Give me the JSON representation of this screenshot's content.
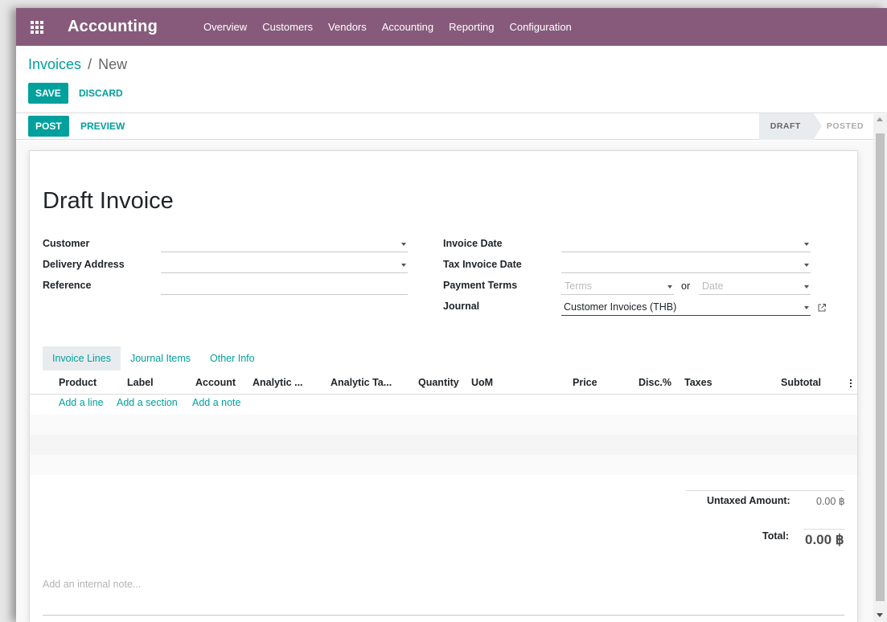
{
  "navbar": {
    "brand": "Accounting",
    "menu": [
      "Overview",
      "Customers",
      "Vendors",
      "Accounting",
      "Reporting",
      "Configuration"
    ]
  },
  "breadcrumb": {
    "parent": "Invoices",
    "separator": "/",
    "current": "New"
  },
  "control": {
    "save": "SAVE",
    "discard": "DISCARD"
  },
  "statusbar": {
    "post": "POST",
    "preview": "PREVIEW",
    "states": [
      "DRAFT",
      "POSTED"
    ]
  },
  "form": {
    "title": "Draft Invoice",
    "left_labels": [
      "Customer",
      "Delivery Address",
      "Reference"
    ],
    "right_labels": [
      "Invoice Date",
      "Tax Invoice Date",
      "Payment Terms",
      "Journal"
    ],
    "terms_placeholder": "Terms",
    "or_text": "or",
    "date_placeholder": "Date",
    "journal_value": "Customer Invoices (THB)"
  },
  "tabs": [
    "Invoice Lines",
    "Journal Items",
    "Other Info"
  ],
  "columns": [
    "Product",
    "Label",
    "Account",
    "Analytic ...",
    "Analytic Ta...",
    "Quantity",
    "UoM",
    "Price",
    "Disc.%",
    "Taxes",
    "Subtotal"
  ],
  "add_actions": [
    "Add a line",
    "Add a section",
    "Add a note"
  ],
  "totals": {
    "untaxed_label": "Untaxed Amount:",
    "untaxed_value": "0.00 ฿",
    "total_label": "Total:",
    "total_value": "0.00 ฿"
  },
  "note_placeholder": "Add an internal note...",
  "colors": {
    "brand": "#875a7b",
    "accent": "#00a09d"
  }
}
